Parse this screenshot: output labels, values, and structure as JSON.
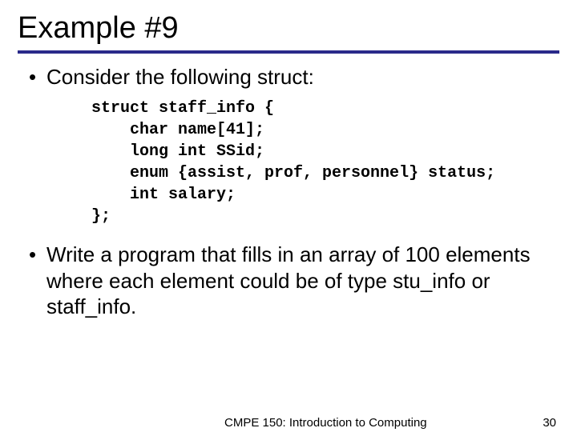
{
  "title": "Example #9",
  "bullets": {
    "b1": "Consider the following struct:",
    "b2": "Write a program that fills in an array of 100 elements where each element could be of type stu_info or staff_info."
  },
  "code": {
    "l1": "struct staff_info {",
    "l2": "    char name[41];",
    "l3": "    long int SSid;",
    "l4": "    enum {assist, prof, personnel} status;",
    "l5": "    int salary;",
    "l6": "};"
  },
  "footer": {
    "course": "CMPE 150: Introduction to Computing",
    "page": "30"
  }
}
